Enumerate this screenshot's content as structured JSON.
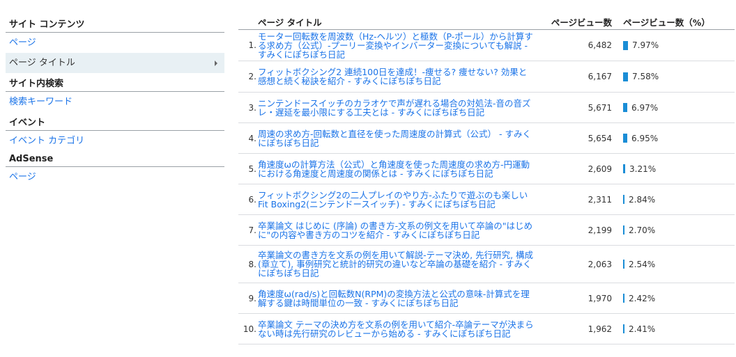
{
  "sidebar": {
    "sections": [
      {
        "heading": "サイト コンテンツ",
        "items": [
          {
            "label": "ページ",
            "selected": false
          },
          {
            "label": "ページ タイトル",
            "selected": true
          }
        ]
      },
      {
        "heading": "サイト内検索",
        "items": [
          {
            "label": "検索キーワード",
            "selected": false
          }
        ]
      },
      {
        "heading": "イベント",
        "items": [
          {
            "label": "イベント カテゴリ",
            "selected": false
          }
        ]
      },
      {
        "heading": "AdSense",
        "items": [
          {
            "label": "ページ",
            "selected": false
          }
        ]
      }
    ]
  },
  "table": {
    "headers": {
      "title": "ページ タイトル",
      "views": "ページビュー数",
      "percent": "ページビュー数（%）"
    },
    "bar_color": "#1a8dd6",
    "rows": [
      {
        "index": "1.",
        "title": "モーター回転数を周波数（Hz-ヘルツ）と極数（P-ポール）から計算する求め方（公式）-プーリー変換やインバーター変換についても解説 - すみくにぽちぽち日記",
        "views": "6,482",
        "percent": "7.97%",
        "percent_value": 7.97
      },
      {
        "index": "2.",
        "title": "フィットボクシング2 連続100日を達成！-痩せる? 痩せない? 効果と感想と続く秘訣を紹介 - すみくにぽちぽち日記",
        "views": "6,167",
        "percent": "7.58%",
        "percent_value": 7.58
      },
      {
        "index": "3.",
        "title": "ニンテンドースイッチのカラオケで声が遅れる場合の対処法-音の音ズレ・遅延を最小限にする工夫とは - すみくにぽちぽち日記",
        "views": "5,671",
        "percent": "6.97%",
        "percent_value": 6.97
      },
      {
        "index": "4.",
        "title": "周速の求め方-回転数と直径を使った周速度の計算式（公式） - すみくにぽちぽち日記",
        "views": "5,654",
        "percent": "6.95%",
        "percent_value": 6.95
      },
      {
        "index": "5.",
        "title": "角速度ωの計算方法（公式）と角速度を使った周速度の求め方-円運動における角速度と周速度の関係とは - すみくにぽちぽち日記",
        "views": "2,609",
        "percent": "3.21%",
        "percent_value": 3.21
      },
      {
        "index": "6.",
        "title": "フィットボクシング2の二人プレイのやり方-ふたりで遊ぶのも楽しいFit Boxing2(ニンテンドースイッチ) - すみくにぽちぽち日記",
        "views": "2,311",
        "percent": "2.84%",
        "percent_value": 2.84
      },
      {
        "index": "7.",
        "title": "卒業論文 はじめに (序論) の書き方-文系の例文を用いて卒論の\"はじめに\"の内容や書き方のコツを紹介 - すみくにぽちぽち日記",
        "views": "2,199",
        "percent": "2.70%",
        "percent_value": 2.7
      },
      {
        "index": "8.",
        "title": "卒業論文の書き方を文系の例を用いて解説-テーマ決め, 先行研究, 構成(章立て), 事例研究と統計的研究の違いなど卒論の基礎を紹介 - すみくにぽちぽち日記",
        "views": "2,063",
        "percent": "2.54%",
        "percent_value": 2.54
      },
      {
        "index": "9.",
        "title": "角速度ω(rad/s)と回転数N(RPM)の変換方法と公式の意味-計算式を理解する鍵は時間単位の一致 - すみくにぽちぽち日記",
        "views": "1,970",
        "percent": "2.42%",
        "percent_value": 2.42
      },
      {
        "index": "10.",
        "title": "卒業論文 テーマの決め方を文系の例を用いて紹介-卒論テーマが決まらない時は先行研究のレビューから始める - すみくにぽちぽち日記",
        "views": "1,962",
        "percent": "2.41%",
        "percent_value": 2.41
      }
    ]
  }
}
